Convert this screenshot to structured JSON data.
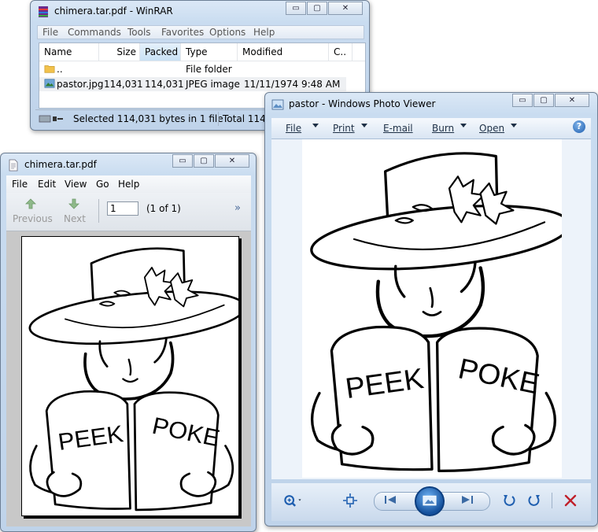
{
  "winrar": {
    "title": "chimera.tar.pdf - WinRAR",
    "menu": [
      "File",
      "Commands",
      "Tools",
      "Favorites",
      "Options",
      "Help"
    ],
    "columns": [
      "Name",
      "Size",
      "Packed",
      "Type",
      "Modified",
      "C.."
    ],
    "rows": [
      {
        "name": "..",
        "size": "",
        "packed": "",
        "type": "File folder",
        "modified": ""
      },
      {
        "name": "pastor.jpg",
        "size": "114,031",
        "packed": "114,031",
        "type": "JPEG image",
        "modified": "11/11/1974 9:48 AM"
      }
    ],
    "status_selected": "Selected 114,031 bytes in 1 file",
    "status_total": "Total 114,0",
    "caption": {
      "minimize": "▭",
      "maximize": "▢",
      "close": "✕"
    }
  },
  "pdfviewer": {
    "title": "chimera.tar.pdf",
    "menu": [
      "File",
      "Edit",
      "View",
      "Go",
      "Help"
    ],
    "previous_label": "Previous",
    "next_label": "Next",
    "page_value": "1",
    "page_count": "(1 of 1)",
    "overflow": "»",
    "caption": {
      "minimize": "▭",
      "maximize": "▢",
      "close": "✕"
    }
  },
  "photoviewer": {
    "title": "pastor - Windows Photo Viewer",
    "menu": [
      "File",
      "Print",
      "E-mail",
      "Burn",
      "Open"
    ],
    "help": "?",
    "caption": {
      "minimize": "▭",
      "maximize": "▢",
      "close": "✕"
    }
  },
  "image": {
    "left_word": "PEEK",
    "right_word": "POKE"
  },
  "colors": {
    "accent": "#1f5fb0",
    "delete_red": "#c0202a",
    "window_frame": "#c9dcf0"
  },
  "icons": [
    "winrar-icon",
    "folder-icon",
    "jpeg-file-icon",
    "document-icon",
    "photo-icon",
    "zoom-icon",
    "fit-icon",
    "prev-icon",
    "slideshow-icon",
    "next-icon",
    "rotate-ccw-icon",
    "rotate-cw-icon",
    "delete-icon",
    "help-icon",
    "up-arrow-icon",
    "down-arrow-icon"
  ]
}
